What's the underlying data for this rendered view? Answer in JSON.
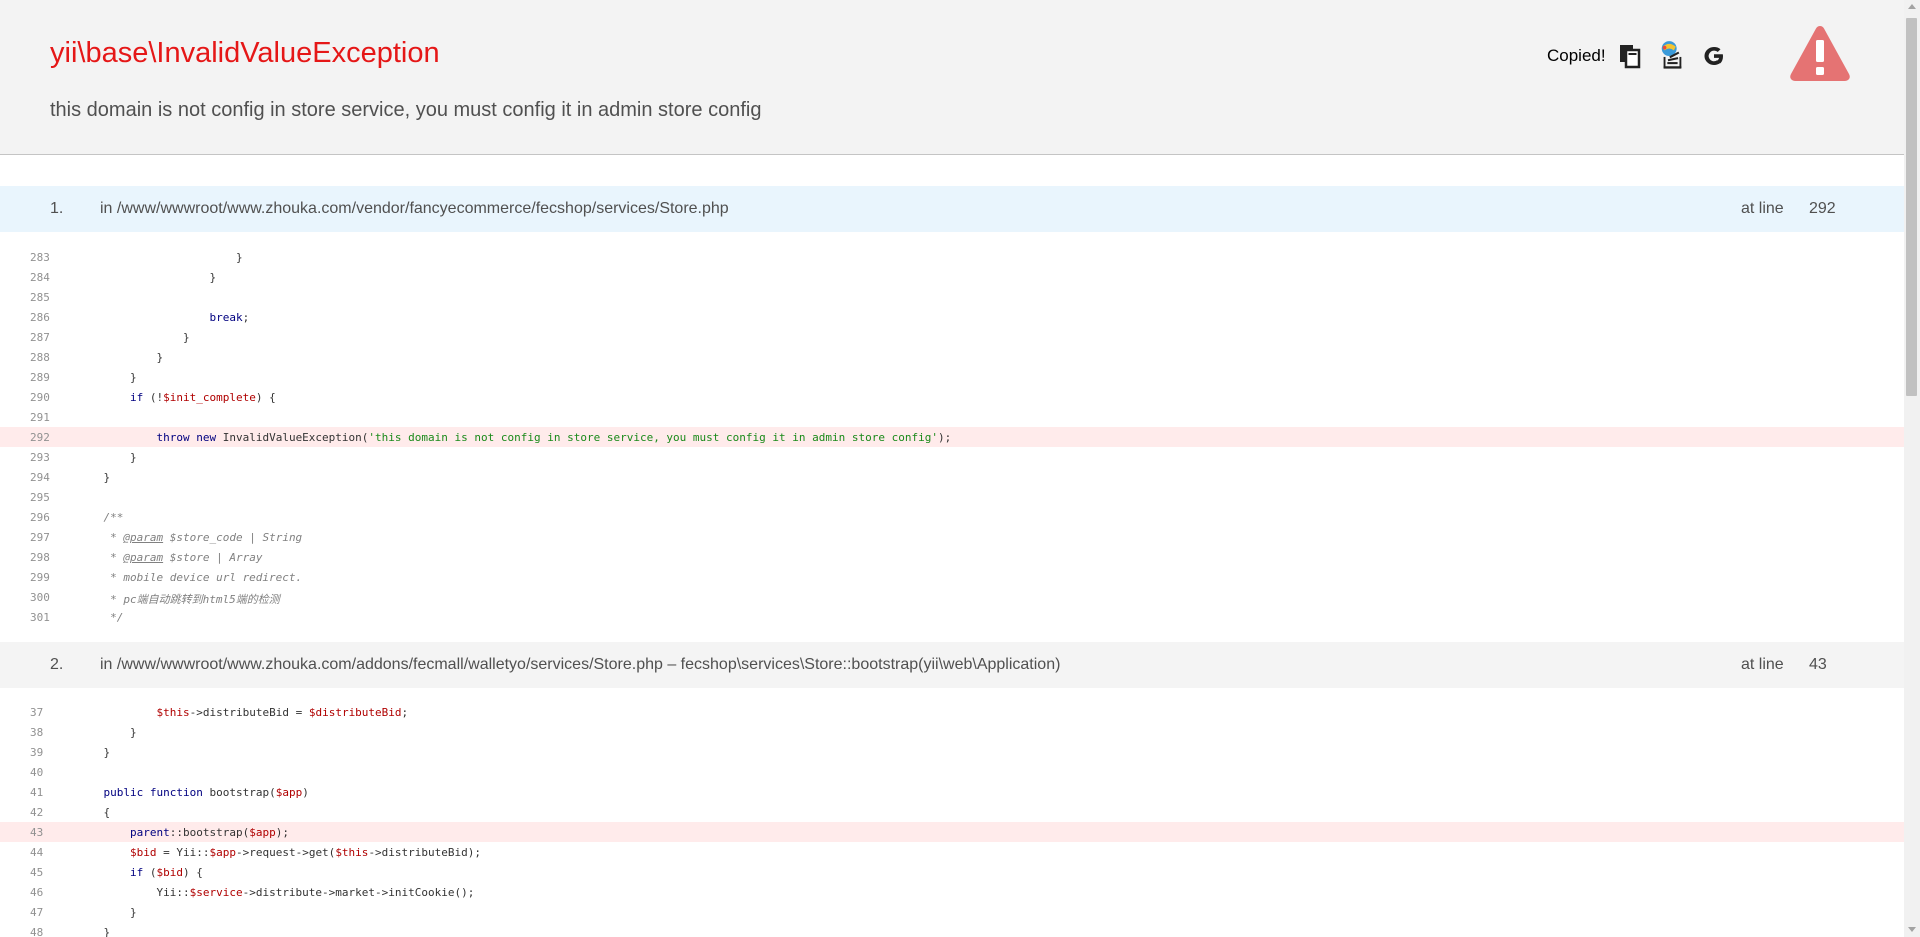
{
  "header": {
    "exception_class": "yii\\base\\InvalidValueException",
    "message": "this domain is not config in store service, you must config it in admin store config",
    "copied_label": "Copied!",
    "icons": [
      "copy-icon",
      "stack-overflow-search-icon",
      "google-search-icon",
      "warning-icon"
    ],
    "colors": {
      "title": "#e51717",
      "warning": "#e57373",
      "error_line": "#ffebeb",
      "app_frame": "#e9f5fd"
    }
  },
  "frames": [
    {
      "number": "1.",
      "file": "in /www/wwwroot/www.zhouka.com/vendor/fancyecommerce/fecshop/services/Store.php",
      "at_line_label": "at line",
      "line": "292",
      "lines": [
        {
          "n": "283",
          "tokens": [
            [
              "p",
              "                        }"
            ]
          ]
        },
        {
          "n": "284",
          "tokens": [
            [
              "p",
              "                    }"
            ]
          ]
        },
        {
          "n": "285",
          "tokens": [
            [
              "p",
              ""
            ]
          ]
        },
        {
          "n": "286",
          "tokens": [
            [
              "p",
              "                    "
            ],
            [
              "k",
              "break"
            ],
            [
              "p",
              ";"
            ]
          ]
        },
        {
          "n": "287",
          "tokens": [
            [
              "p",
              "                }"
            ]
          ]
        },
        {
          "n": "288",
          "tokens": [
            [
              "p",
              "            }"
            ]
          ]
        },
        {
          "n": "289",
          "tokens": [
            [
              "p",
              "        }"
            ]
          ]
        },
        {
          "n": "290",
          "tokens": [
            [
              "p",
              "        "
            ],
            [
              "k",
              "if"
            ],
            [
              "p",
              " (!"
            ],
            [
              "v",
              "$init_complete"
            ],
            [
              "p",
              ") {"
            ]
          ]
        },
        {
          "n": "291",
          "tokens": [
            [
              "p",
              ""
            ]
          ]
        },
        {
          "n": "292",
          "err": true,
          "tokens": [
            [
              "p",
              "            "
            ],
            [
              "k",
              "throw new"
            ],
            [
              "p",
              " InvalidValueException("
            ],
            [
              "s",
              "'this domain is not config in store service, you must config it in admin store config'"
            ],
            [
              "p",
              ");"
            ]
          ]
        },
        {
          "n": "293",
          "tokens": [
            [
              "p",
              "        }"
            ]
          ]
        },
        {
          "n": "294",
          "tokens": [
            [
              "p",
              "    }"
            ]
          ]
        },
        {
          "n": "295",
          "tokens": [
            [
              "p",
              ""
            ]
          ]
        },
        {
          "n": "296",
          "tokens": [
            [
              "c",
              "    /**"
            ]
          ]
        },
        {
          "n": "297",
          "tokens": [
            [
              "c",
              "     * "
            ],
            [
              "cu",
              "@param"
            ],
            [
              "c",
              " $store_code | String"
            ]
          ]
        },
        {
          "n": "298",
          "tokens": [
            [
              "c",
              "     * "
            ],
            [
              "cu",
              "@param"
            ],
            [
              "c",
              " $store | Array"
            ]
          ]
        },
        {
          "n": "299",
          "tokens": [
            [
              "c",
              "     * mobile device url redirect."
            ]
          ]
        },
        {
          "n": "300",
          "tokens": [
            [
              "c",
              "     * pc端自动跳转到html5端的检测"
            ]
          ]
        },
        {
          "n": "301",
          "tokens": [
            [
              "c",
              "     */"
            ]
          ]
        }
      ]
    },
    {
      "number": "2.",
      "file": "in /www/wwwroot/www.zhouka.com/addons/fecmall/walletyo/services/Store.php – fecshop\\services\\Store::bootstrap(yii\\web\\Application)",
      "at_line_label": "at line",
      "line": "43",
      "lines": [
        {
          "n": "37",
          "tokens": [
            [
              "p",
              "            "
            ],
            [
              "v",
              "$this"
            ],
            [
              "p",
              "->distributeBid = "
            ],
            [
              "v",
              "$distributeBid"
            ],
            [
              "p",
              ";"
            ]
          ]
        },
        {
          "n": "38",
          "tokens": [
            [
              "p",
              "        }"
            ]
          ]
        },
        {
          "n": "39",
          "tokens": [
            [
              "p",
              "    }"
            ]
          ]
        },
        {
          "n": "40",
          "tokens": [
            [
              "p",
              ""
            ]
          ]
        },
        {
          "n": "41",
          "tokens": [
            [
              "p",
              "    "
            ],
            [
              "k",
              "public function"
            ],
            [
              "p",
              " bootstrap("
            ],
            [
              "v",
              "$app"
            ],
            [
              "p",
              ")"
            ]
          ]
        },
        {
          "n": "42",
          "tokens": [
            [
              "p",
              "    {"
            ]
          ]
        },
        {
          "n": "43",
          "err": true,
          "tokens": [
            [
              "p",
              "        "
            ],
            [
              "k",
              "parent"
            ],
            [
              "p",
              "::bootstrap("
            ],
            [
              "v",
              "$app"
            ],
            [
              "p",
              ");"
            ]
          ]
        },
        {
          "n": "44",
          "tokens": [
            [
              "p",
              "        "
            ],
            [
              "v",
              "$bid"
            ],
            [
              "p",
              " = Yii::"
            ],
            [
              "v",
              "$app"
            ],
            [
              "p",
              "->request->get("
            ],
            [
              "v",
              "$this"
            ],
            [
              "p",
              "->distributeBid);"
            ]
          ]
        },
        {
          "n": "45",
          "tokens": [
            [
              "p",
              "        "
            ],
            [
              "k",
              "if"
            ],
            [
              "p",
              " ("
            ],
            [
              "v",
              "$bid"
            ],
            [
              "p",
              ") {"
            ]
          ]
        },
        {
          "n": "46",
          "tokens": [
            [
              "p",
              "            Yii::"
            ],
            [
              "v",
              "$service"
            ],
            [
              "p",
              "->distribute->market->initCookie();"
            ]
          ]
        },
        {
          "n": "47",
          "tokens": [
            [
              "p",
              "        }"
            ]
          ]
        },
        {
          "n": "48",
          "tokens": [
            [
              "p",
              "    }"
            ]
          ]
        }
      ]
    }
  ]
}
